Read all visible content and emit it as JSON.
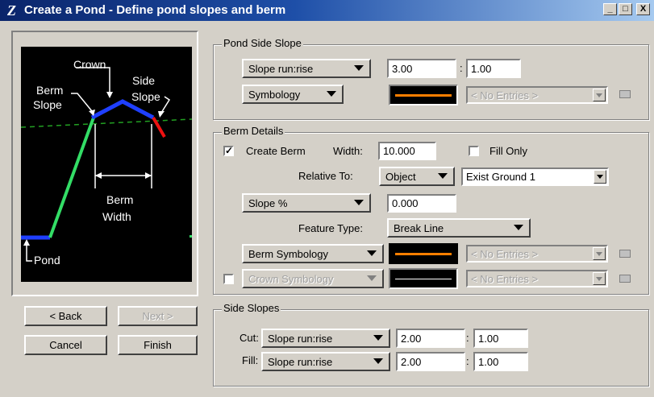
{
  "window": {
    "title": "Create a Pond - Define pond slopes and berm",
    "minimize": "_",
    "maximize": "□",
    "close": "X"
  },
  "diagram": {
    "crown": "Crown",
    "berm_slope_1": "Berm",
    "berm_slope_2": "Slope",
    "side_slope_1": "Side",
    "side_slope_2": "Slope",
    "berm_width_1": "Berm",
    "berm_width_2": "Width",
    "pond": "Pond"
  },
  "nav": {
    "back": "< Back",
    "next": "Next >",
    "cancel": "Cancel",
    "finish": "Finish"
  },
  "pond_side_slope": {
    "label": "Pond Side Slope",
    "mode": "Slope run:rise",
    "run": "3.00",
    "colon": ":",
    "rise": "1.00",
    "symbology": "Symbology",
    "symbology_color": "#ff7f00",
    "entries": "< No Entries >"
  },
  "berm_details": {
    "label": "Berm Details",
    "create_berm_label": "Create Berm",
    "create_berm_checked": "✓",
    "width_label": "Width:",
    "width_value": "10.000",
    "fill_only_label": "Fill Only",
    "relative_to_label": "Relative To:",
    "relative_to_value": "Object",
    "surface": "Exist Ground 1",
    "slope_mode": "Slope %",
    "slope_value": "0.000",
    "feature_type_label": "Feature Type:",
    "feature_type_value": "Break Line",
    "berm_symbology": "Berm Symbology",
    "berm_symbology_color": "#ff7f00",
    "berm_entries": "< No Entries >",
    "crown_symbology": "Crown Symbology",
    "crown_symbology_color": "#ffffff",
    "crown_entries": "< No Entries >"
  },
  "side_slopes": {
    "label": "Side Slopes",
    "cut_label": "Cut:",
    "cut_mode": "Slope run:rise",
    "cut_run": "2.00",
    "cut_rise": "1.00",
    "fill_label": "Fill:",
    "fill_mode": "Slope run:rise",
    "fill_run": "2.00",
    "fill_rise": "1.00",
    "colon": ":"
  }
}
